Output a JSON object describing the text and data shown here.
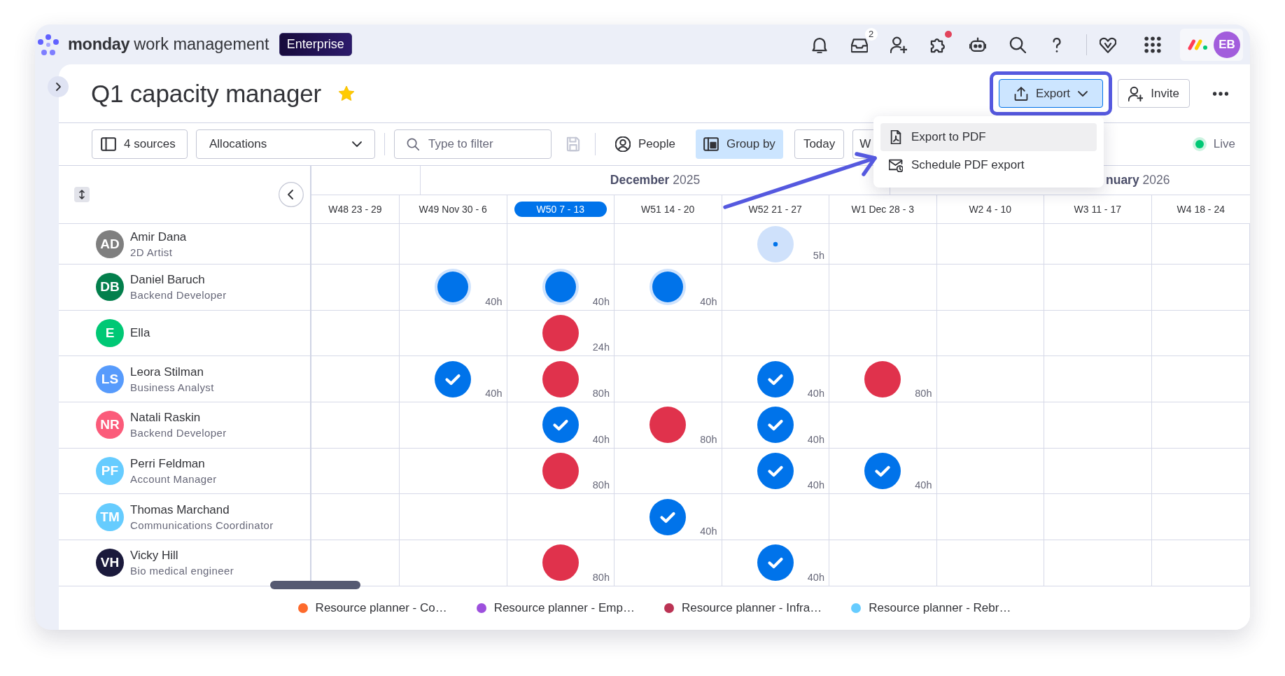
{
  "top_bar": {
    "brand": "monday",
    "product": "work management",
    "plan_badge": "Enterprise",
    "inbox_badge": "2",
    "extensions_dot": true,
    "avatar_initials": "EB"
  },
  "header": {
    "title": "Q1 capacity manager",
    "favorite": true,
    "export_button": {
      "label": "Export",
      "open": true
    },
    "invite_button": "Invite"
  },
  "callout": {
    "frame": true,
    "arrow": true
  },
  "toolbar": {
    "sources": "4 sources",
    "view": "Allocations",
    "filter": {
      "placeholder": "Type to filter"
    },
    "save_disabled": true,
    "toggles": [
      {
        "label": "People",
        "selected": false
      },
      {
        "label": "Group by",
        "selected": true
      }
    ],
    "nav_buttons": [
      "Today",
      "W"
    ],
    "live": {
      "label": "Live",
      "on": true
    }
  },
  "export_menu": {
    "items": [
      {
        "label": "Export to PDF",
        "selected": true
      },
      {
        "label": "Schedule PDF export",
        "selected": false
      }
    ]
  },
  "timeline": {
    "months": [
      "**December** 2025",
      "**nuary** 2026"
    ],
    "weeks": [
      {
        "label": "W48 23 - 29",
        "selected": false
      },
      {
        "label": "W49 Nov 30 - 6",
        "selected": false
      },
      {
        "label": "W50 7 - 13",
        "selected": true
      },
      {
        "label": "W51 14 - 20",
        "selected": false
      },
      {
        "label": "W52 21 - 27",
        "selected": false
      },
      {
        "label": "W1 Dec 28 - 3",
        "selected": false
      },
      {
        "label": "W2 4 - 10",
        "selected": false
      },
      {
        "label": "W3 11 - 17",
        "selected": false
      },
      {
        "label": "W4 18 - 24",
        "selected": false
      }
    ]
  },
  "people": [
    {
      "initials": "AD",
      "name": "Amir Dana",
      "role": "2D Artist",
      "color": "#7f7f7f",
      "cells": [
        {
          "kind": "empty"
        },
        {
          "kind": "empty"
        },
        {
          "kind": "empty"
        },
        {
          "kind": "empty"
        },
        {
          "kind": "partial",
          "hours": "5h"
        },
        {
          "kind": "empty"
        },
        {
          "kind": "empty"
        },
        {
          "kind": "empty"
        },
        {
          "kind": "empty"
        }
      ]
    },
    {
      "initials": "DB",
      "name": "Daniel Baruch",
      "role": "Backend Developer",
      "color": "#037f4c",
      "cells": [
        {
          "kind": "empty"
        },
        {
          "kind": "planned",
          "hours": "40h"
        },
        {
          "kind": "planned",
          "hours": "40h"
        },
        {
          "kind": "planned",
          "hours": "40h"
        },
        {
          "kind": "empty"
        },
        {
          "kind": "empty"
        },
        {
          "kind": "empty"
        },
        {
          "kind": "empty"
        },
        {
          "kind": "empty"
        }
      ]
    },
    {
      "initials": "E",
      "name": "Ella",
      "color": "#00c875",
      "cells": [
        {
          "kind": "empty"
        },
        {
          "kind": "empty"
        },
        {
          "kind": "over",
          "hours": "24h"
        },
        {
          "kind": "empty"
        },
        {
          "kind": "empty"
        },
        {
          "kind": "empty"
        },
        {
          "kind": "empty"
        },
        {
          "kind": "empty"
        },
        {
          "kind": "empty"
        }
      ]
    },
    {
      "initials": "LS",
      "name": "Leora Stilman",
      "role": "Business Analyst",
      "color": "#579bfc",
      "cells": [
        {
          "kind": "empty"
        },
        {
          "kind": "done",
          "hours": "40h"
        },
        {
          "kind": "over",
          "hours": "80h"
        },
        {
          "kind": "empty"
        },
        {
          "kind": "done",
          "hours": "40h"
        },
        {
          "kind": "over",
          "hours": "80h"
        },
        {
          "kind": "empty"
        },
        {
          "kind": "empty"
        },
        {
          "kind": "empty"
        }
      ]
    },
    {
      "initials": "NR",
      "name": "Natali Raskin",
      "role": "Backend Developer",
      "color": "#fb5b7a",
      "cells": [
        {
          "kind": "empty"
        },
        {
          "kind": "empty"
        },
        {
          "kind": "done",
          "hours": "40h"
        },
        {
          "kind": "over",
          "hours": "80h"
        },
        {
          "kind": "done",
          "hours": "40h"
        },
        {
          "kind": "empty"
        },
        {
          "kind": "empty"
        },
        {
          "kind": "empty"
        },
        {
          "kind": "empty"
        }
      ]
    },
    {
      "initials": "PF",
      "name": "Perri Feldman",
      "role": "Account Manager",
      "color": "#66ccff",
      "cells": [
        {
          "kind": "empty"
        },
        {
          "kind": "empty"
        },
        {
          "kind": "over",
          "hours": "80h"
        },
        {
          "kind": "empty"
        },
        {
          "kind": "done",
          "hours": "40h"
        },
        {
          "kind": "done",
          "hours": "40h"
        },
        {
          "kind": "empty"
        },
        {
          "kind": "empty"
        },
        {
          "kind": "empty"
        }
      ]
    },
    {
      "initials": "TM",
      "name": "Thomas Marchand",
      "role": "Communications Coordinator",
      "color": "#66ccfe",
      "cells": [
        {
          "kind": "empty"
        },
        {
          "kind": "empty"
        },
        {
          "kind": "empty"
        },
        {
          "kind": "done",
          "hours": "40h"
        },
        {
          "kind": "empty"
        },
        {
          "kind": "empty"
        },
        {
          "kind": "empty"
        },
        {
          "kind": "empty"
        },
        {
          "kind": "empty"
        }
      ]
    },
    {
      "initials": "VH",
      "name": "Vicky Hill",
      "role": "Bio medical engineer",
      "color": "#1b1a3c",
      "cells": [
        {
          "kind": "empty"
        },
        {
          "kind": "empty"
        },
        {
          "kind": "over",
          "hours": "80h"
        },
        {
          "kind": "empty"
        },
        {
          "kind": "done",
          "hours": "40h"
        },
        {
          "kind": "empty"
        },
        {
          "kind": "empty"
        },
        {
          "kind": "empty"
        },
        {
          "kind": "empty"
        }
      ]
    }
  ],
  "legend": [
    {
      "label": "Resource planner - Co…",
      "color": "#fd6a2c"
    },
    {
      "label": "Resource planner - Emp…",
      "color": "#9d50dd"
    },
    {
      "label": "Resource planner - Infra…",
      "color": "#bb3354"
    },
    {
      "label": "Resource planner - Rebr…",
      "color": "#66ccff"
    }
  ]
}
